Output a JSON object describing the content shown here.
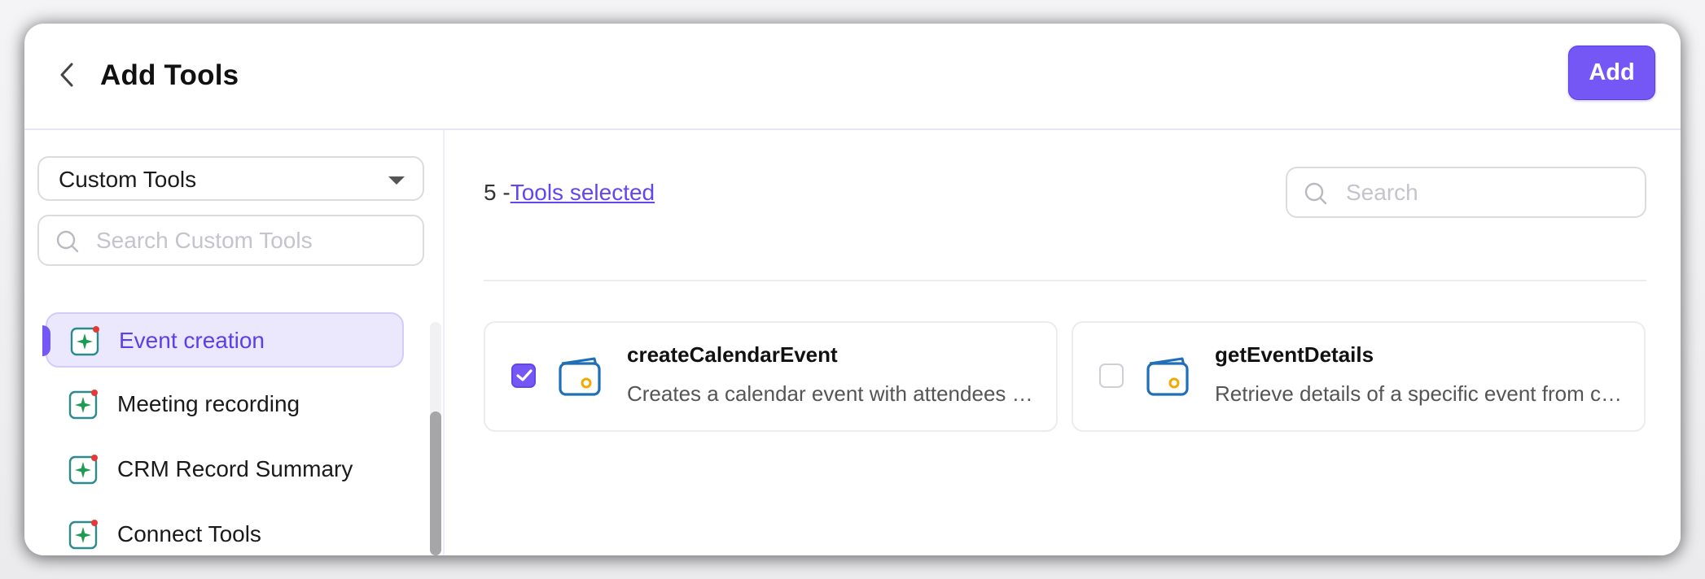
{
  "header": {
    "title": "Add Tools",
    "add_label": "Add",
    "back_icon": "chevron-left-icon"
  },
  "sidebar": {
    "dropdown_value": "Custom Tools",
    "search_placeholder": "Search Custom Tools",
    "items": [
      {
        "label": "Event creation",
        "icon": "sparkle-app-icon",
        "active": true
      },
      {
        "label": "Meeting recording",
        "icon": "sparkle-app-icon",
        "active": false
      },
      {
        "label": "CRM Record Summary",
        "icon": "sparkle-app-icon",
        "active": false
      },
      {
        "label": "Connect Tools",
        "icon": "sparkle-app-icon",
        "active": false
      }
    ]
  },
  "main": {
    "selected_count": "5 -",
    "selected_link": "Tools selected",
    "search_placeholder": "Search",
    "tools": [
      {
        "name": "createCalendarEvent",
        "description": "Creates a calendar event with attendees and details",
        "checked": true,
        "icon": "calendar-icon"
      },
      {
        "name": "getEventDetails",
        "description": "Retrieve details of a specific event from calendar",
        "checked": false,
        "icon": "calendar-icon"
      }
    ]
  },
  "colors": {
    "accent": "#7557f5",
    "active_bg": "#ebe8fd",
    "link": "#6446ee"
  }
}
